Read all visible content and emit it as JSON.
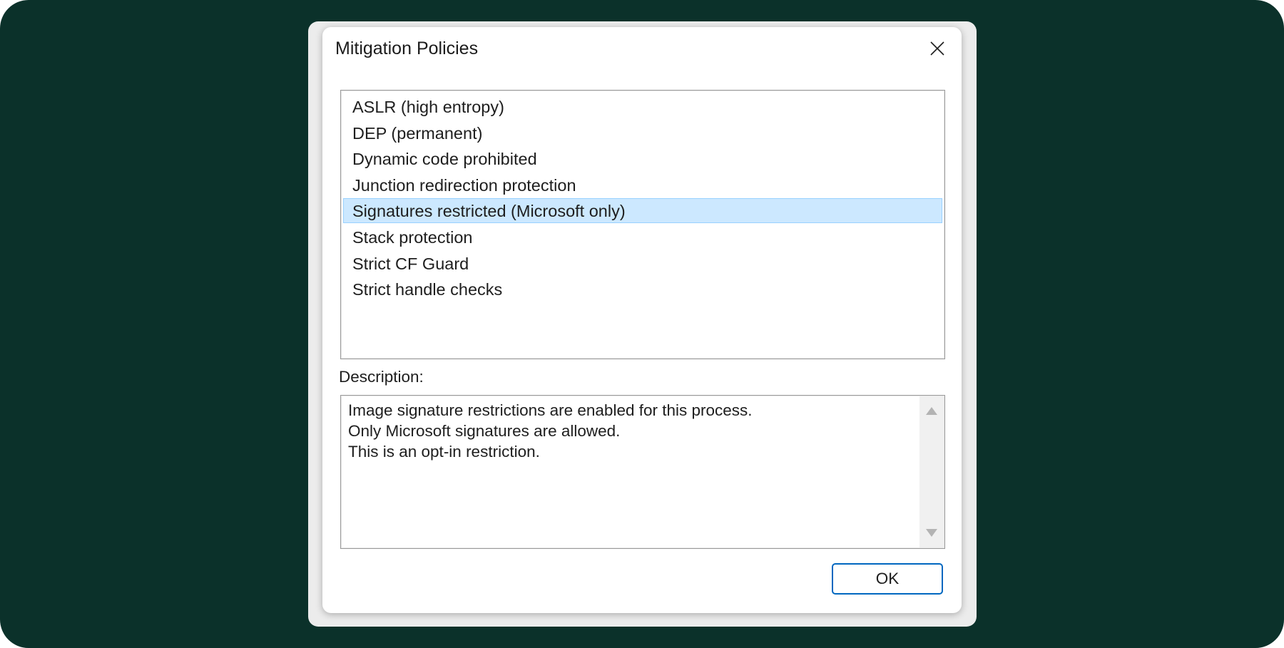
{
  "window": {
    "title": "Mitigation Policies",
    "close_icon": "close-icon"
  },
  "policies": {
    "items": [
      {
        "label": "ASLR (high entropy)",
        "selected": false
      },
      {
        "label": "DEP (permanent)",
        "selected": false
      },
      {
        "label": "Dynamic code prohibited",
        "selected": false
      },
      {
        "label": "Junction redirection protection",
        "selected": false
      },
      {
        "label": "Signatures restricted (Microsoft only)",
        "selected": true
      },
      {
        "label": "Stack protection",
        "selected": false
      },
      {
        "label": "Strict CF Guard",
        "selected": false
      },
      {
        "label": "Strict handle checks",
        "selected": false
      }
    ]
  },
  "description": {
    "label": "Description:",
    "lines": [
      "Image signature restrictions are enabled for this process.",
      "Only Microsoft signatures are allowed.",
      "This is an opt-in restriction."
    ]
  },
  "footer": {
    "ok_label": "OK"
  },
  "colors": {
    "background": "#0b312a",
    "selection": "#cce8ff",
    "selection_border": "#99d1ff",
    "accent": "#0067c0"
  }
}
